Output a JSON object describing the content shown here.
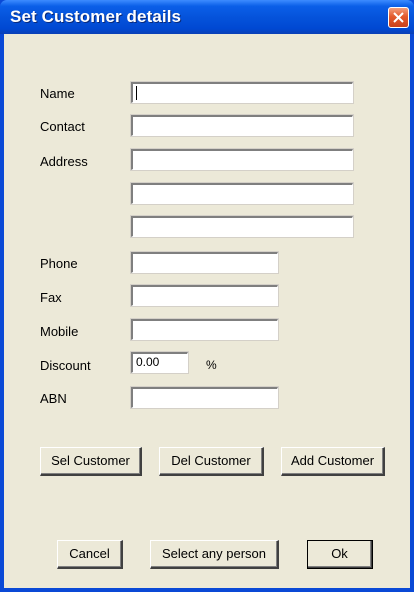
{
  "window": {
    "title": "Set Customer details"
  },
  "form": {
    "name_label": "Name",
    "name_value": "",
    "contact_label": "Contact",
    "contact_value": "",
    "address_label": "Address",
    "address_line1_value": "",
    "address_line2_value": "",
    "address_line3_value": "",
    "phone_label": "Phone",
    "phone_value": "",
    "fax_label": "Fax",
    "fax_value": "",
    "mobile_label": "Mobile",
    "mobile_value": "",
    "discount_label": "Discount",
    "discount_value": "0.00",
    "discount_unit": "%",
    "abn_label": "ABN",
    "abn_value": ""
  },
  "customer_buttons": {
    "sel_label": "Sel Customer",
    "del_label": "Del Customer",
    "add_label": "Add Customer"
  },
  "dialog_buttons": {
    "cancel_label": "Cancel",
    "select_any_label": "Select any person",
    "ok_label": "Ok"
  },
  "colors": {
    "titlebar": "#0553db",
    "dialog_bg": "#ece9d8",
    "close_button": "#e35a2c"
  }
}
